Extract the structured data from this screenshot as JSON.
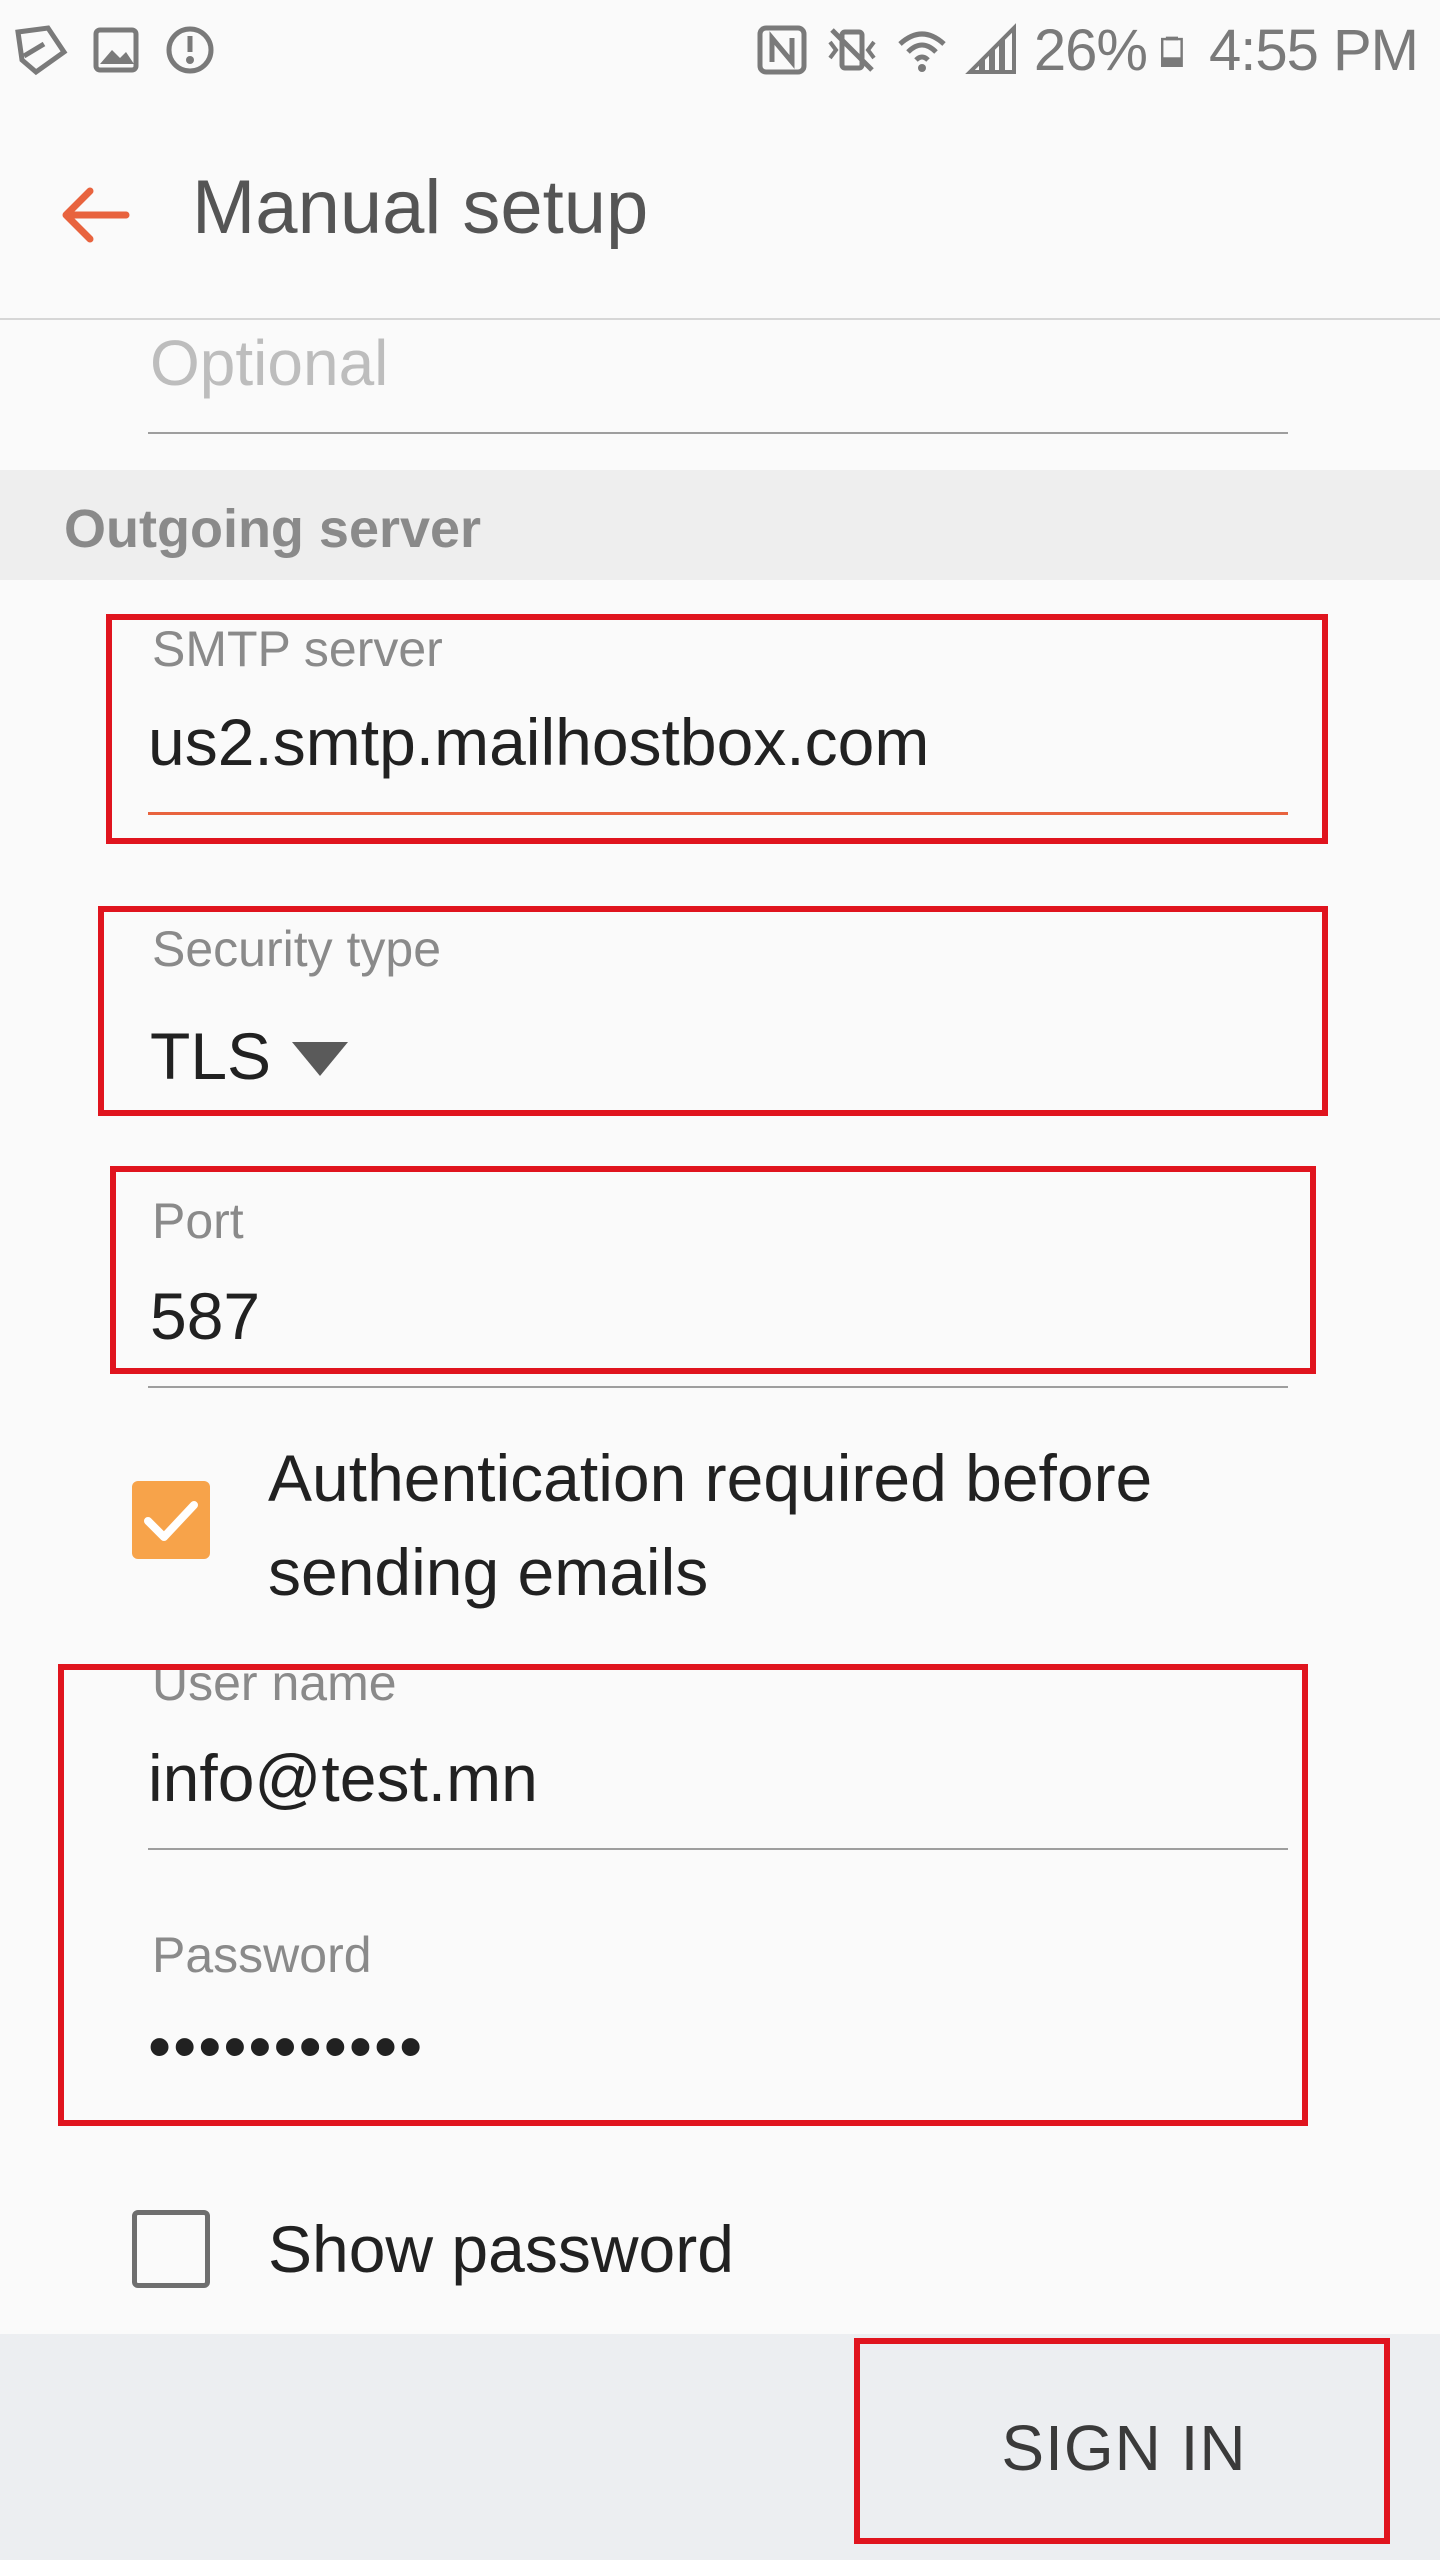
{
  "status_bar": {
    "battery": "26%",
    "time": "4:55 PM"
  },
  "header": {
    "title": "Manual setup"
  },
  "incoming_partial": {
    "placeholder": "Optional"
  },
  "outgoing": {
    "section_title": "Outgoing server",
    "smtp_label": "SMTP server",
    "smtp_value": "us2.smtp.mailhostbox.com",
    "security_label": "Security type",
    "security_value": "TLS",
    "port_label": "Port",
    "port_value": "587",
    "auth_label": "Authentication required before sending emails",
    "auth_checked": true,
    "username_label": "User name",
    "username_value": "info@test.mn",
    "password_label": "Password",
    "password_value": "•••••••••••",
    "show_password_label": "Show password",
    "show_password_checked": false
  },
  "footer": {
    "sign_in_label": "SIGN IN"
  },
  "colors": {
    "accent": "#e8633e",
    "checkbox_checked": "#f7a34a",
    "highlight": "#e0141e"
  }
}
